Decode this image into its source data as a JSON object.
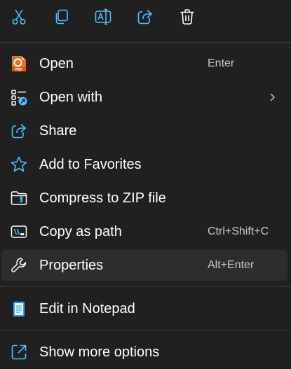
{
  "toolbar": {
    "icons": [
      "cut-icon",
      "copy-icon",
      "rename-icon",
      "share-icon",
      "delete-icon"
    ]
  },
  "items": [
    {
      "label": "Open",
      "shortcut": "Enter",
      "icon": "pdf-app-icon"
    },
    {
      "label": "Open with",
      "shortcut": "",
      "icon": "open-with-icon"
    },
    {
      "label": "Share",
      "shortcut": "",
      "icon": "share-icon"
    },
    {
      "label": "Add to Favorites",
      "shortcut": "",
      "icon": "star-icon"
    },
    {
      "label": "Compress to ZIP file",
      "shortcut": "",
      "icon": "zip-icon"
    },
    {
      "label": "Copy as path",
      "shortcut": "Ctrl+Shift+C",
      "icon": "copy-path-icon"
    },
    {
      "label": "Properties",
      "shortcut": "Alt+Enter",
      "icon": "wrench-icon"
    },
    {
      "label": "Edit in Notepad",
      "shortcut": "",
      "icon": "notepad-icon"
    },
    {
      "label": "Show more options",
      "shortcut": "",
      "icon": "show-more-icon"
    }
  ],
  "colors": {
    "accent": "#4cc2ff",
    "background": "#202020",
    "hover": "#2d2d2d",
    "text": "#ffffff",
    "secondary_text": "#c8c8c8"
  }
}
